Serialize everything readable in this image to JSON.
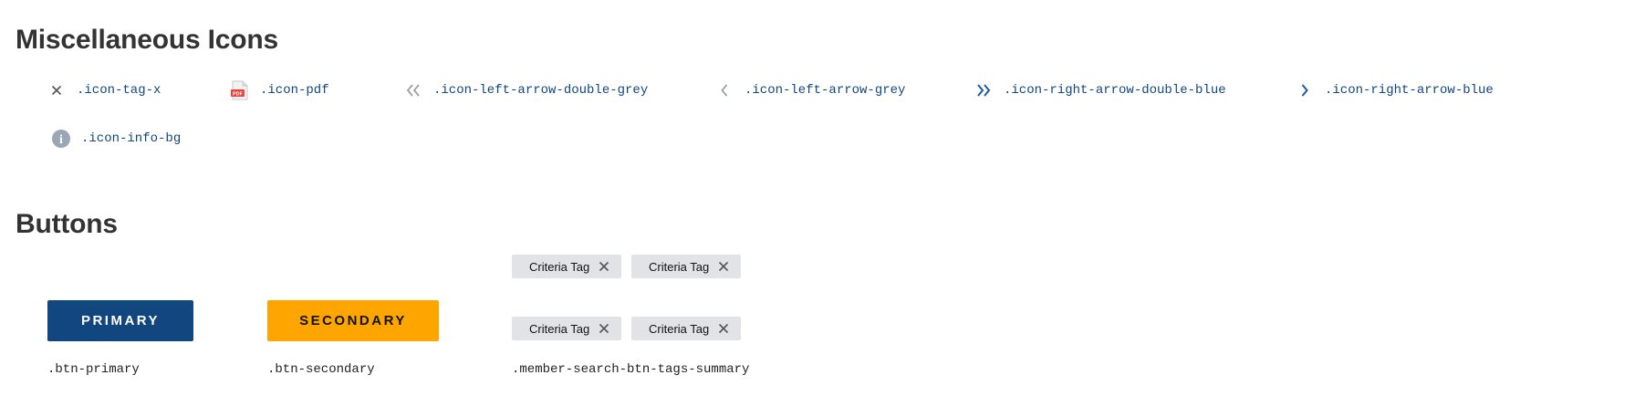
{
  "sections": {
    "icons_title": "Miscellaneous Icons",
    "buttons_title": "Buttons"
  },
  "icons": [
    {
      "icon": "close-icon",
      "label": ".icon-tag-x",
      "color": "#555555"
    },
    {
      "icon": "pdf-file-icon",
      "label": ".icon-pdf",
      "color": "#e8423a"
    },
    {
      "icon": "double-chevron-left-icon",
      "label": ".icon-left-arrow-double-grey",
      "color": "#9aa1a9"
    },
    {
      "icon": "chevron-left-icon",
      "label": ".icon-left-arrow-grey",
      "color": "#9aa1a9"
    },
    {
      "icon": "double-chevron-right-icon",
      "label": ".icon-right-arrow-double-blue",
      "color": "#1c5aa3"
    },
    {
      "icon": "chevron-right-icon",
      "label": ".icon-right-arrow-blue",
      "color": "#1c5aa3"
    },
    {
      "icon": "info-circle-icon",
      "label": ".icon-info-bg",
      "color": "#9aa7b6"
    }
  ],
  "pdf_badge_text": "PDF",
  "info_glyph": "i",
  "buttons": {
    "primary": {
      "label": "PRIMARY",
      "caption": ".btn-primary",
      "bg": "#11467f",
      "fg": "#ffffff"
    },
    "secondary": {
      "label": "SECONDARY",
      "caption": ".btn-secondary",
      "bg": "#ffa500",
      "fg": "#111111"
    }
  },
  "tags": {
    "items": [
      {
        "label": "Criteria Tag"
      },
      {
        "label": "Criteria Tag"
      },
      {
        "label": "Criteria Tag"
      },
      {
        "label": "Criteria Tag"
      }
    ],
    "caption": ".member-search-btn-tags-summary",
    "bg": "#e1e3e6"
  }
}
